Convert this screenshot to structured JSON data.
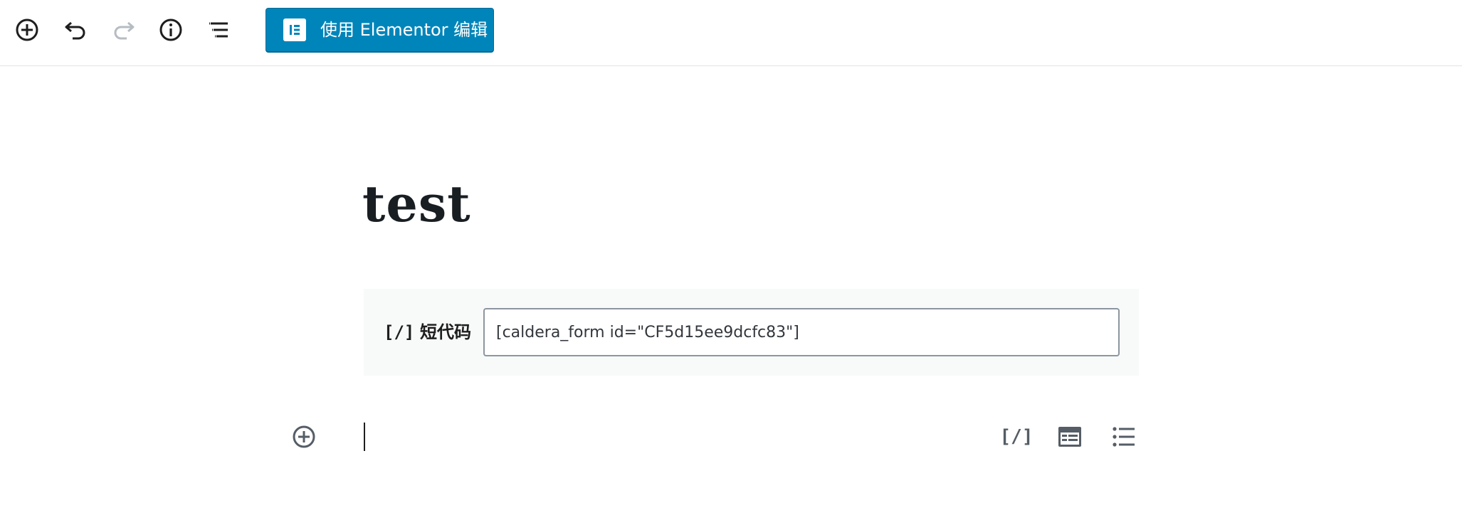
{
  "toolbar": {
    "add_block_title": "Add block",
    "undo_title": "Undo",
    "redo_title": "Redo",
    "info_title": "Content structure",
    "outline_title": "Block navigation",
    "elementor_label": "使用 Elementor 编辑"
  },
  "post": {
    "title": "test"
  },
  "shortcode_block": {
    "icon_text": "[/]",
    "label": "短代码",
    "value": "[caldera_form id=\"CF5d15ee9dcfc83\"]"
  },
  "appender": {
    "shortcode_icon_text": "[/]"
  },
  "colors": {
    "accent": "#0085ba",
    "toolbar_border": "#e2e4e7",
    "block_bg": "#f8f9f9",
    "icon": "#555d66"
  }
}
